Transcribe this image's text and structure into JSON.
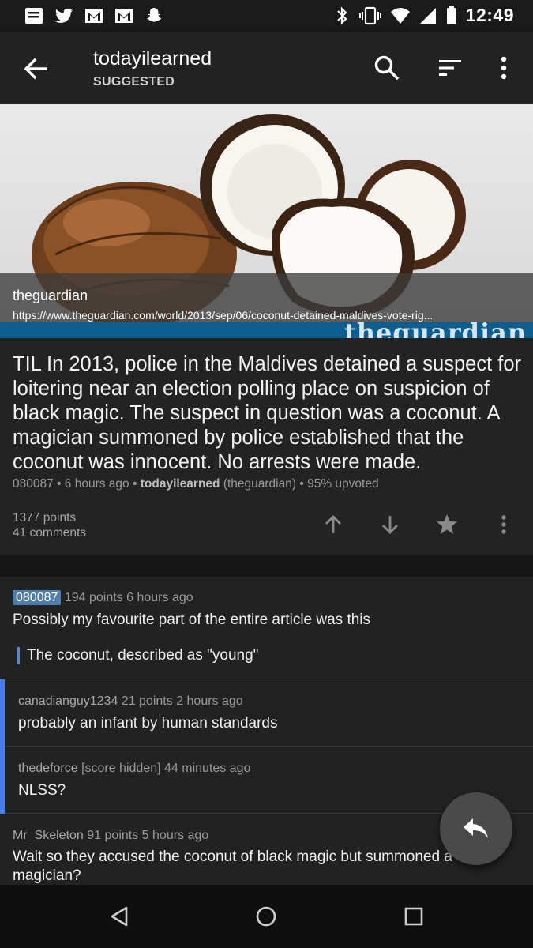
{
  "status_bar": {
    "time": "12:49",
    "left_icons": [
      "inbox-icon",
      "twitter-icon",
      "gmail-icon",
      "gmail-icon",
      "snapchat-icon"
    ],
    "right_icons": [
      "bluetooth-icon",
      "vibrate-icon",
      "wifi-icon",
      "cell-signal-icon",
      "battery-icon"
    ]
  },
  "app_bar": {
    "title": "todayilearned",
    "subtitle": "SUGGESTED",
    "icons": [
      "back-arrow-icon",
      "search-icon",
      "sort-icon",
      "overflow-menu-icon"
    ]
  },
  "link_preview": {
    "source": "theguardian",
    "url": "https://www.theguardian.com/world/2013/sep/06/coconut-detained-maldives-vote-rig...",
    "banner_text": "theguardian"
  },
  "post": {
    "title": "TIL In 2013, police in the Maldives detained a suspect for loitering near an election polling place on suspicion of black magic. The suspect in question was a coconut. A magician summoned by police established that the coconut was innocent. No arrests were made.",
    "author": "080087",
    "age": "6 hours ago",
    "subreddit": "todayilearned",
    "domain": "(theguardian)",
    "upvoted": "95% upvoted",
    "sep": "•",
    "points": "1377 points",
    "comments": "41 comments"
  },
  "comments": [
    {
      "author": "080087",
      "is_op": true,
      "score": "194 points",
      "age": "6 hours ago",
      "body": "Possibly my favourite part of the entire article was this",
      "quote": "The coconut, described as \"young\""
    },
    {
      "author": "canadianguy1234",
      "score": "21 points",
      "age": "2 hours ago",
      "body": "probably an infant by human standards"
    },
    {
      "author": "thedeforce",
      "score": "[score hidden]",
      "age": "44 minutes ago",
      "body": "NLSS?"
    },
    {
      "author": "Mr_Skeleton",
      "score": "91 points",
      "age": "5 hours ago",
      "body": "Wait so they accused the coconut of black magic but summoned a magician?"
    }
  ],
  "colors": {
    "background": "#1f1f1f",
    "op_badge": "#4d7fa8",
    "indent_bar": "#4a7df0"
  }
}
